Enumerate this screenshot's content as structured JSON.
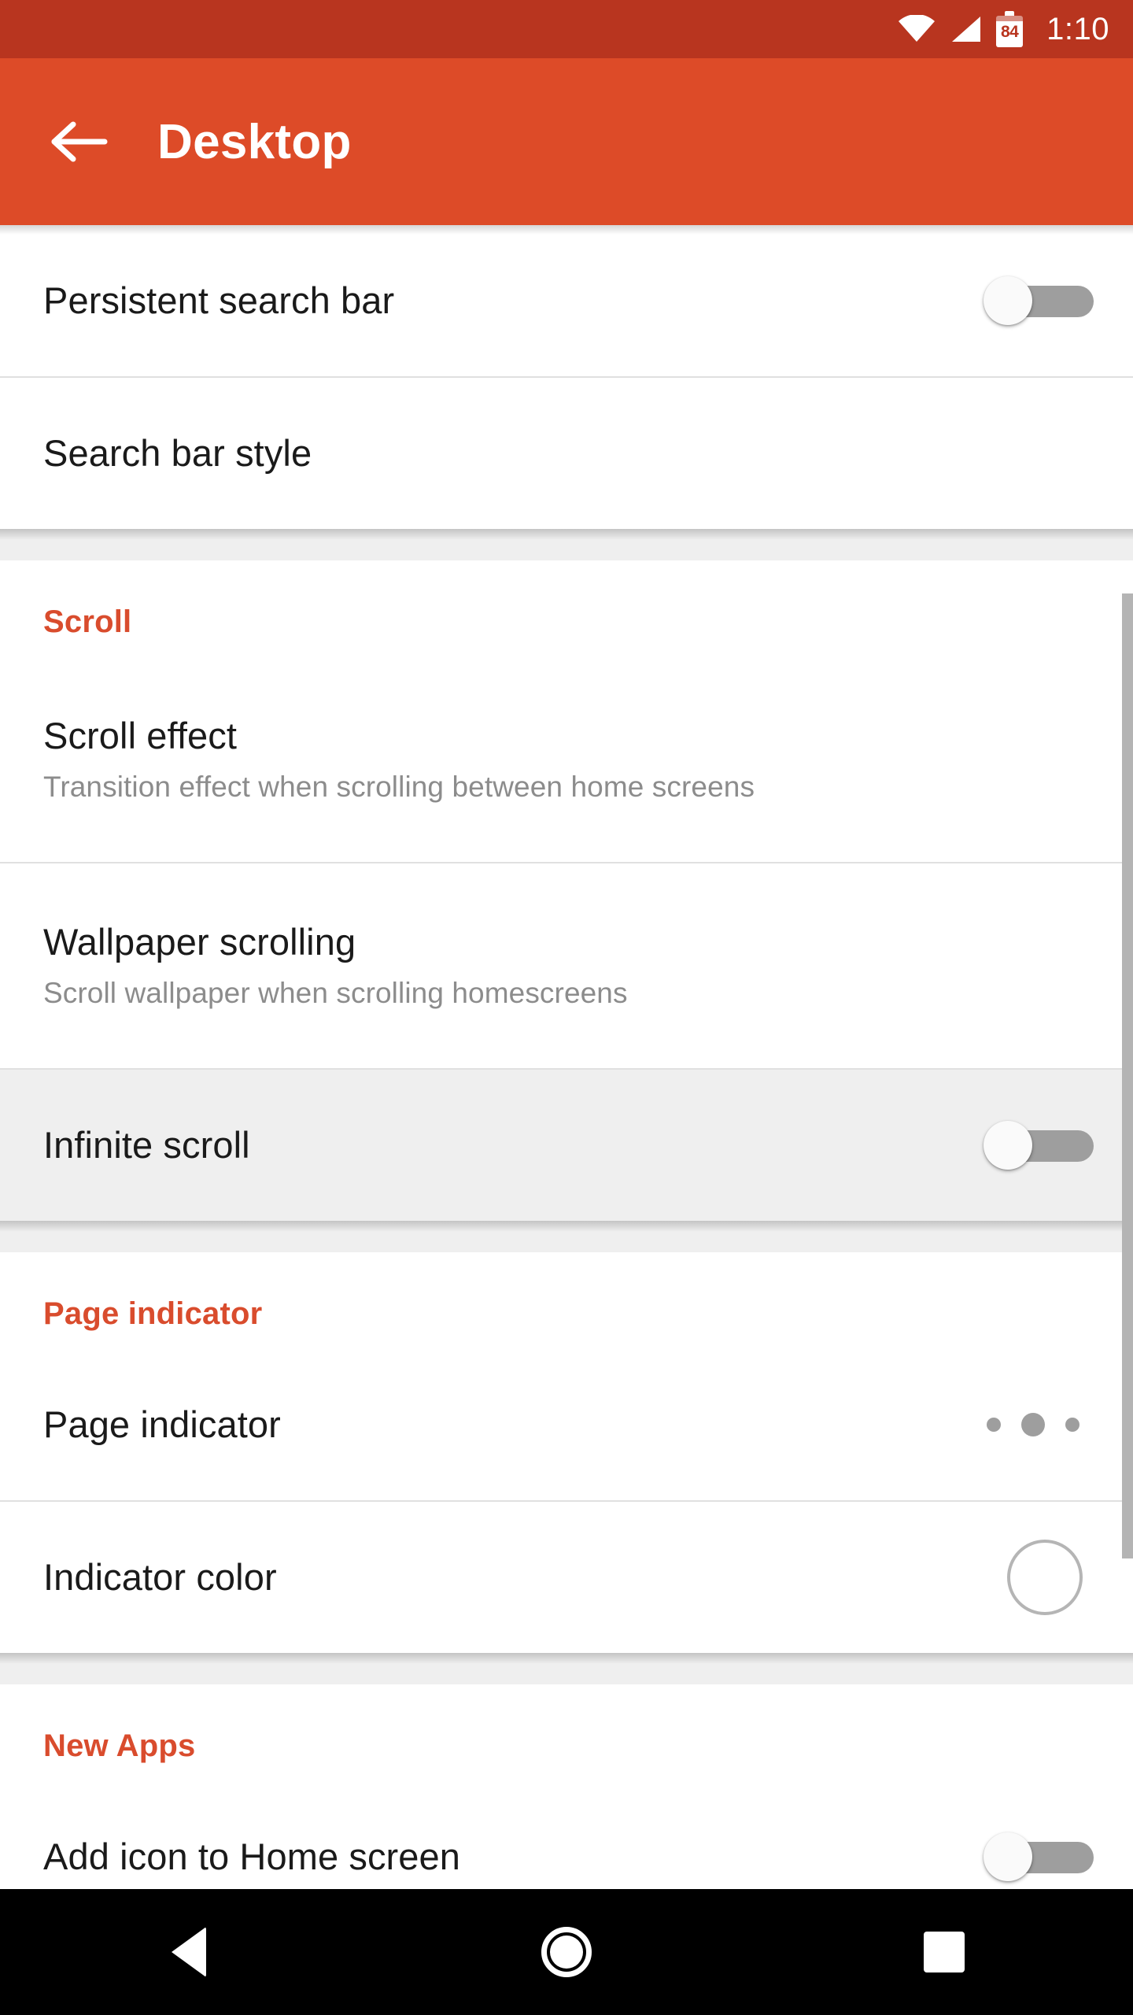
{
  "status_bar": {
    "time": "1:10",
    "battery_percent": "84",
    "wifi_icon": "wifi-icon",
    "signal_icon": "signal-icon",
    "battery_icon": "battery-icon",
    "background_color": "#b8351f"
  },
  "app_bar": {
    "title": "Desktop",
    "back_icon": "arrow-left-icon",
    "background_color": "#dd4b28",
    "title_color": "#ffffff"
  },
  "theme": {
    "accent_color": "#d94c2d",
    "section_header_color": "#d94c2d",
    "title_color": "#1a1a1a",
    "subtitle_color": "#8c8c8c",
    "highlight_row_color": "#efefef",
    "divider_color": "#e0e0e0",
    "switch_track_color": "#9e9e9e",
    "switch_thumb_color": "#fafafa",
    "dot_color": "#9e9e9e",
    "swatch_border_color": "#b5b5b5",
    "scrollbar_color": "#b4b4b4"
  },
  "sections": [
    {
      "header": null,
      "rows": [
        {
          "title": "Persistent search bar",
          "subtitle": null,
          "control": "switch",
          "switch_state": "off",
          "highlighted": false
        },
        {
          "title": "Search bar style",
          "subtitle": null,
          "control": "none",
          "highlighted": false
        }
      ]
    },
    {
      "header": "Scroll",
      "rows": [
        {
          "title": "Scroll effect",
          "subtitle": "Transition effect when scrolling between home screens",
          "control": "none",
          "highlighted": false
        },
        {
          "title": "Wallpaper scrolling",
          "subtitle": "Scroll wallpaper when scrolling homescreens",
          "control": "none",
          "highlighted": false
        },
        {
          "title": "Infinite scroll",
          "subtitle": null,
          "control": "switch",
          "switch_state": "off",
          "highlighted": true
        }
      ]
    },
    {
      "header": "Page indicator",
      "rows": [
        {
          "title": "Page indicator",
          "subtitle": null,
          "control": "dots",
          "highlighted": false
        },
        {
          "title": "Indicator color",
          "subtitle": null,
          "control": "color-swatch",
          "swatch_color": "#ffffff",
          "highlighted": false
        }
      ]
    },
    {
      "header": "New Apps",
      "rows": [
        {
          "title": "Add icon to Home screen",
          "subtitle": null,
          "control": "switch",
          "switch_state": "off",
          "highlighted": false
        }
      ]
    }
  ],
  "nav_bar": {
    "back_label": "Back",
    "home_label": "Home",
    "recents_label": "Recents",
    "background_color": "#000000"
  }
}
